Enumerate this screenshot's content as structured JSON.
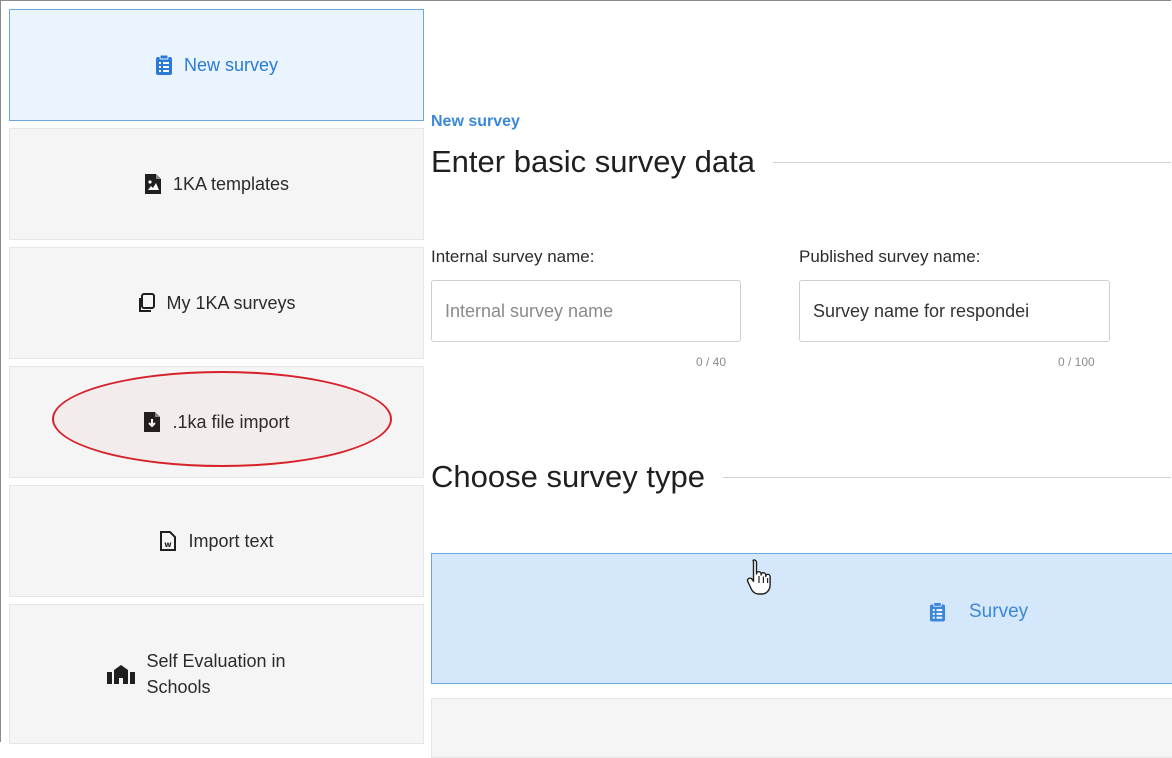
{
  "sidebar": {
    "items": [
      {
        "label": "New survey",
        "icon": "clipboard-list-icon",
        "active": true
      },
      {
        "label": "1KA templates",
        "icon": "file-image-icon"
      },
      {
        "label": "My 1KA surveys",
        "icon": "copy-icon"
      },
      {
        "label": ".1ka file import",
        "icon": "file-import-icon"
      },
      {
        "label": "Import text",
        "icon": "file-word-icon"
      },
      {
        "label_line1": "Self Evaluation in",
        "label_line2": "Schools",
        "icon": "school-icon"
      }
    ]
  },
  "main": {
    "breadcrumb": "New survey",
    "basic_section_title": "Enter basic survey data",
    "internal_name": {
      "label": "Internal survey name:",
      "placeholder": "Internal survey name",
      "value": "",
      "counter": "0 / 40"
    },
    "published_name": {
      "label": "Published survey name:",
      "value": "Survey name for respondei",
      "counter": "0 / 100"
    },
    "type_section_title": "Choose survey type",
    "type_options": [
      {
        "label": "Survey",
        "icon": "clipboard-list-icon",
        "selected": true
      }
    ]
  },
  "colors": {
    "accent": "#3b87d8",
    "active_bg": "#eaf4ff",
    "selected_card_bg": "#d4e7fb",
    "annotation": "#d6202a"
  }
}
